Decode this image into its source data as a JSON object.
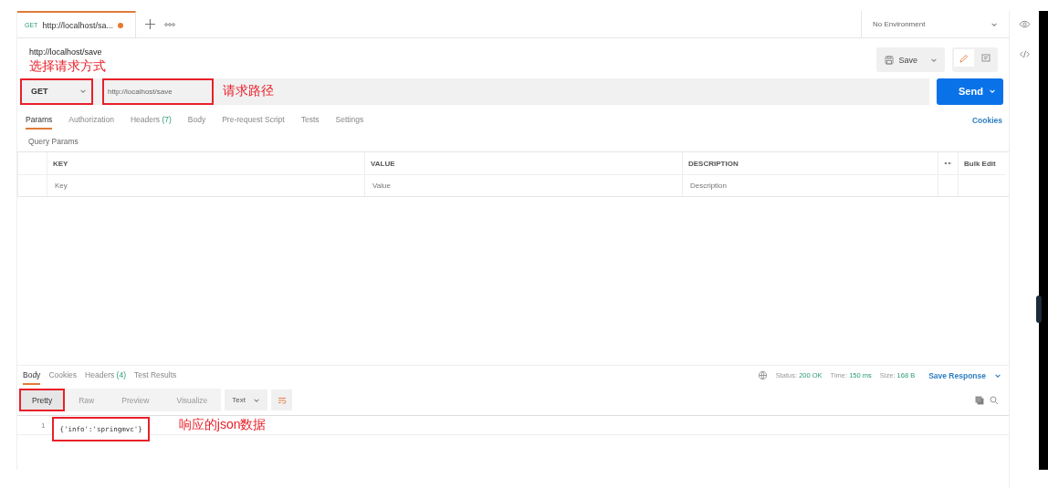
{
  "request_tab": {
    "method": "GET",
    "title": "http://localhost/sa...",
    "unsaved": true
  },
  "environment": {
    "label": "No Environment"
  },
  "request_name": "http://localhost/save",
  "save_button": "Save",
  "method_select": {
    "value": "GET"
  },
  "url_field": {
    "value": "http://localhost/save"
  },
  "send_button": "Send",
  "request_tabs": [
    {
      "label": "Params",
      "selected": true
    },
    {
      "label": "Authorization",
      "selected": false
    },
    {
      "label": "Headers",
      "count": "(7)",
      "selected": false
    },
    {
      "label": "Body",
      "selected": false
    },
    {
      "label": "Pre-request Script",
      "selected": false
    },
    {
      "label": "Tests",
      "selected": false
    },
    {
      "label": "Settings",
      "selected": false
    }
  ],
  "cookies_link": "Cookies",
  "query_params": {
    "title": "Query Params",
    "columns": [
      "KEY",
      "VALUE",
      "DESCRIPTION"
    ],
    "bulk_edit": "Bulk Edit",
    "placeholders": [
      "Key",
      "Value",
      "Description"
    ]
  },
  "response_tabs": [
    {
      "label": "Body",
      "selected": true
    },
    {
      "label": "Cookies",
      "selected": false
    },
    {
      "label": "Headers",
      "count": "(4)",
      "selected": false
    },
    {
      "label": "Test Results",
      "selected": false
    }
  ],
  "status": [
    {
      "label": "Status:",
      "value": "200 OK"
    },
    {
      "label": "Time:",
      "value": "150 ms"
    },
    {
      "label": "Size:",
      "value": "168 B"
    }
  ],
  "save_response": "Save Response",
  "view_modes": [
    {
      "label": "Pretty",
      "selected": true
    },
    {
      "label": "Raw",
      "selected": false
    },
    {
      "label": "Preview",
      "selected": false
    },
    {
      "label": "Visualize",
      "selected": false
    }
  ],
  "format_select": "Text",
  "response_lines": [
    {
      "number": "1",
      "code": "{'info':'springmvc'}"
    }
  ],
  "method_note": "选择请求方式",
  "url_note": "请求路径",
  "response_note": "响应的json数据"
}
